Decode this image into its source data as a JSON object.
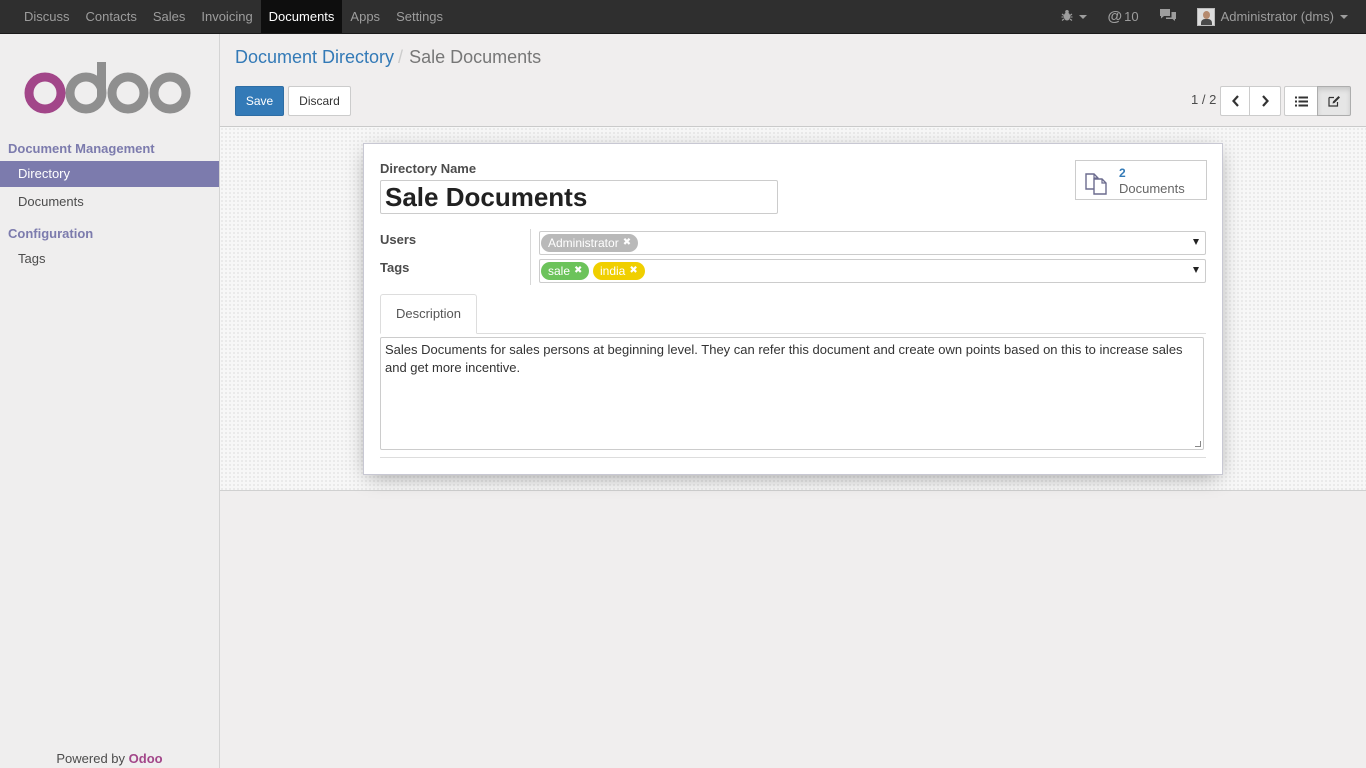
{
  "navbar": {
    "menu": [
      "Discuss",
      "Contacts",
      "Sales",
      "Invoicing",
      "Documents",
      "Apps",
      "Settings"
    ],
    "active": "Documents",
    "messages_count": "10",
    "user": "Administrator (dms)"
  },
  "sidebar": {
    "logo_text": "odoo",
    "section_main": "Document Management",
    "item_directory": "Directory",
    "item_documents": "Documents",
    "section_config": "Configuration",
    "item_tags": "Tags",
    "powered_prefix": "Powered by",
    "powered_brand": "Odoo"
  },
  "breadcrumb": {
    "parent": "Document Directory",
    "separator": "/",
    "current": "Sale Documents"
  },
  "toolbar": {
    "save_label": "Save",
    "discard_label": "Discard",
    "pager": "1 / 2"
  },
  "form": {
    "name_label": "Directory Name",
    "name_value": "Sale Documents",
    "smart_count": "2",
    "smart_label": "Documents",
    "users_label": "Users",
    "users": [
      "Administrator"
    ],
    "tags_label": "Tags",
    "tags": [
      {
        "name": "sale",
        "color": "#6cc35b"
      },
      {
        "name": "india",
        "color": "#f0cf00"
      }
    ],
    "tab_description": "Description",
    "description": "Sales Documents for sales persons at beginning level. They can refer this document and create own points based on this to increase sales and get more incentive."
  },
  "colors": {
    "navbar": "#2f2f2f",
    "accent": "#7c7bad",
    "primary": "#337ab7",
    "brand": "#a24689",
    "user_badge": "#b9b9b9"
  }
}
